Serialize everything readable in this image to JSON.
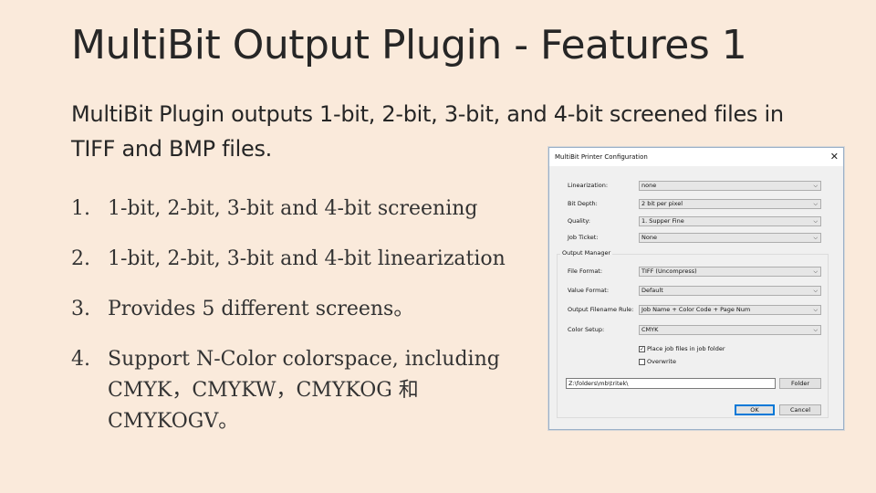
{
  "slide": {
    "title": "MultiBit Output Plugin - Features 1",
    "intro": "MultiBit Plugin outputs 1-bit, 2-bit, 3-bit, and 4-bit screened files in TIFF and BMP files.",
    "features": [
      {
        "num": "1.",
        "text": "1-bit, 2-bit, 3-bit and 4-bit screening"
      },
      {
        "num": "2.",
        "text": "1-bit, 2-bit, 3-bit and 4-bit linearization"
      },
      {
        "num": "3.",
        "text": "Provides 5 different screens。"
      },
      {
        "num": "4.",
        "text": "Support N-Color colorspace, including CMYK，CMYKW，CMYKOG 和CMYKOGV。"
      }
    ]
  },
  "dialog": {
    "title": "MultiBit Printer Configuration",
    "close_icon": "close-icon",
    "linearization": {
      "label": "Linearization:",
      "value": "none"
    },
    "bit_depth": {
      "label": "Bit Depth:",
      "value": "2 bit per pixel"
    },
    "quality": {
      "label": "Quality:",
      "value": "1. Supper Fine"
    },
    "job_ticket": {
      "label": "Job Ticket:",
      "value": "None"
    },
    "output_manager": {
      "legend": "Output Manager",
      "file_format": {
        "label": "File Format:",
        "value": "TIFF (Uncompress)"
      },
      "value_format": {
        "label": "Value Format:",
        "value": "Default"
      },
      "filename_rule": {
        "label": "Output Filename Rule:",
        "value": "Job Name + Color Code + Page Num"
      },
      "color_setup": {
        "label": "Color Setup:",
        "value": "CMYK"
      },
      "place_in_folder": {
        "label": "Place job files in job folder",
        "checked": true
      },
      "overwrite": {
        "label": "Overwrite",
        "checked": false
      },
      "path": "Z:\\folders\\mb\\tritek\\",
      "folder_button": "Folder"
    },
    "ok_button": "OK",
    "cancel_button": "Cancel"
  }
}
